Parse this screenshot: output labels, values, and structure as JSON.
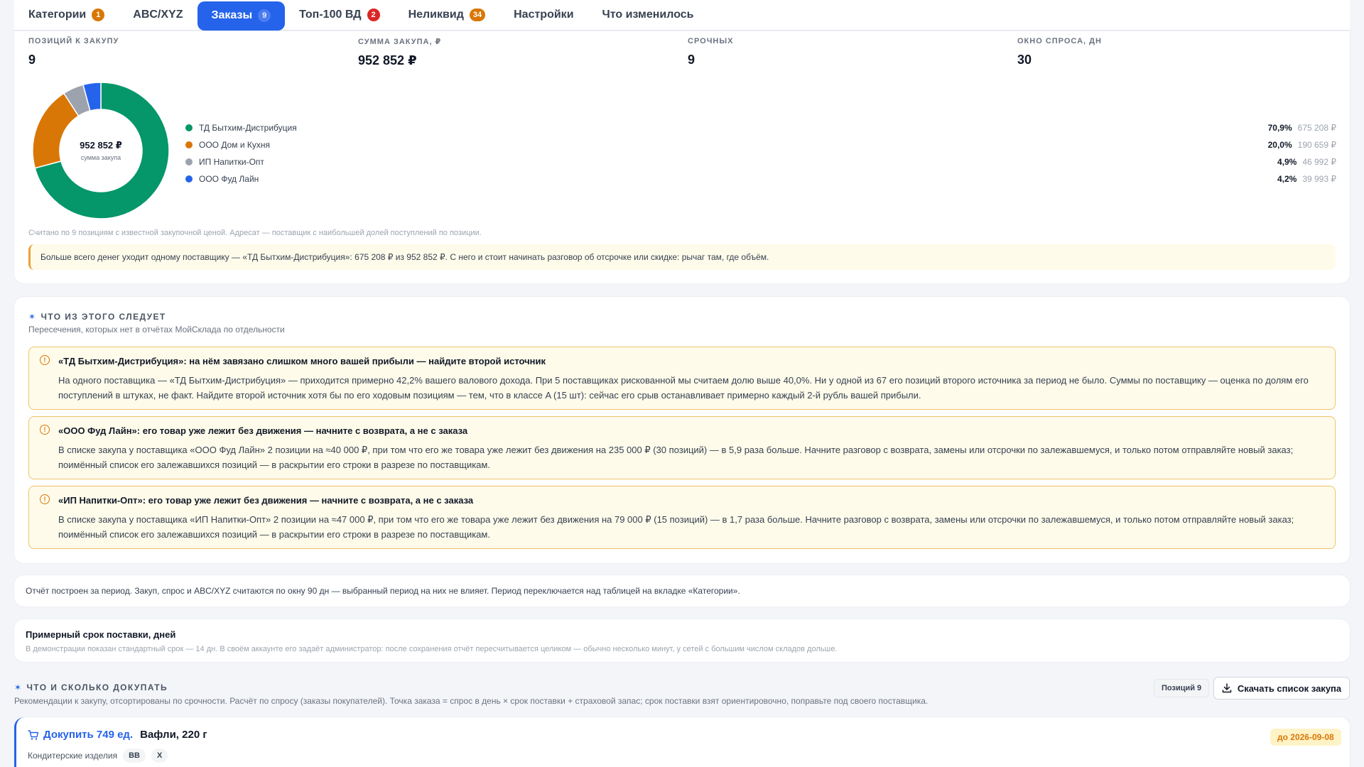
{
  "tabs": [
    {
      "label": "Категории",
      "badge": "1"
    },
    {
      "label": "ABC/XYZ"
    },
    {
      "label": "Заказы",
      "badge": "9"
    },
    {
      "label": "Топ-100 ВД",
      "badge": "2"
    },
    {
      "label": "Неликвид",
      "badge": "34"
    },
    {
      "label": "Настройки"
    },
    {
      "label": "Что изменилось"
    }
  ],
  "kpis": [
    {
      "label": "ПОЗИЦИЙ К ЗАКУПУ",
      "value": "9"
    },
    {
      "label": "СУММА ЗАКУПА, ₽",
      "value": "952 852 ₽"
    },
    {
      "label": "СРОЧНЫХ",
      "value": "9"
    },
    {
      "label": "ОКНО СПРОСА, ДН",
      "value": "30"
    }
  ],
  "donut": {
    "center_value": "952 852 ₽",
    "center_label": "сумма закупа"
  },
  "chart_data": {
    "type": "pie",
    "categories": [
      "ТД Бытхим-Дистрибуция",
      "ООО Дом и Кухня",
      "ИП Напитки-Опт",
      "ООО Фуд Лайн"
    ],
    "values": [
      675208,
      190659,
      46992,
      39993
    ],
    "colors": [
      "#059669",
      "#d97706",
      "#9ca3af",
      "#2563eb"
    ],
    "percent_labels": [
      "70,9%",
      "20,0%",
      "4,9%",
      "4,2%"
    ],
    "amount_labels": [
      "675 208 ₽",
      "190 659 ₽",
      "46 992 ₽",
      "39 993 ₽"
    ]
  },
  "summary": {
    "note": "Считано по 9 позициям с известной закупочной ценой. Адресат — поставщик с наибольшей долей поступлений по позиции.",
    "callout": "Больше всего денег уходит одному поставщику — «ТД Бытхим-Дистрибуция»: 675 208 ₽ из 952 852 ₽. С него и стоит начинать разговор об отсрочке или скидке: рычаг там, где объём."
  },
  "insights": {
    "title": "ЧТО ИЗ ЭТОГО СЛЕДУЕТ",
    "subtitle": "Пересечения, которых нет в отчётах МойСклада по отдельности",
    "items": [
      {
        "title": "«ТД Бытхим-Дистрибуция»: на нём завязано слишком много вашей прибыли — найдите второй источник",
        "body": "На одного поставщика — «ТД Бытхим-Дистрибуция» — приходится примерно 42,2% вашего валового дохода. При 5 поставщиках рискованной мы считаем долю выше 40,0%. Ни у одной из 67 его позиций второго источника за период не было. Суммы по поставщику — оценка по долям его поступлений в штуках, не факт. Найдите второй источник хотя бы по его ходовым позициям — тем, что в классе A (15 шт): сейчас его срыв останавливает примерно каждый 2-й рубль вашей прибыли."
      },
      {
        "title": "«ООО Фуд Лайн»: его товар уже лежит без движения — начните с возврата, а не с заказа",
        "body": "В списке закупа у поставщика «ООО Фуд Лайн» 2 позиции на ≈40 000 ₽, при том что его же товара уже лежит без движения на 235 000 ₽ (30 позиций) — в 5,9 раза больше. Начните разговор с возврата, замены или отсрочки по залежавшемуся, и только потом отправляйте новый заказ; поимённый список его залежавшихся позиций — в раскрытии его строки в разрезе по поставщикам."
      },
      {
        "title": "«ИП Напитки-Опт»: его товар уже лежит без движения — начните с возврата, а не с заказа",
        "body": "В списке закупа у поставщика «ИП Напитки-Опт» 2 позиции на ≈47 000 ₽, при том что его же товара уже лежит без движения на 79 000 ₽ (15 позиций) — в 1,7 раза больше. Начните разговор с возврата, замены или отсрочки по залежавшемуся, и только потом отправляйте новый заказ; поимённый список его залежавшихся позиций — в раскрытии его строки в разрезе по поставщикам."
      }
    ]
  },
  "period_note": "Отчёт построен за период. Закуп, спрос и ABC/XYZ считаются по окну 90 дн — выбранный период на них не влияет. Период переключается над таблицей на вкладке «Категории».",
  "lead_time": {
    "title": "Примерный срок поставки, дней",
    "subtitle": "В демонстрации показан стандартный срок — 14 дн. В своём аккаунте его задаёт администратор: после сохранения отчёт пересчитывается целиком — обычно несколько минут, у сетей с большим числом складов дольше."
  },
  "buy_section": {
    "title": "ЧТО И СКОЛЬКО ДОКУПАТЬ",
    "subtitle": "Рекомендации к закупу, отсортированы по срочности. Расчёт по спросу (заказы покупателей). Точка заказа = спрос в день × срок поставки + страховой запас; срок поставки взят ориентировочно, поправьте под своего поставщика.",
    "positions_chip": "Позиций 9",
    "download_label": "Скачать список закупа"
  },
  "item": {
    "buy_label": "Докупить 749 ед.",
    "name": "Вафли, 220 г",
    "category": "Кондитерские изделия",
    "chips": [
      "BB",
      "X"
    ],
    "due": "до 2026-09-08"
  }
}
